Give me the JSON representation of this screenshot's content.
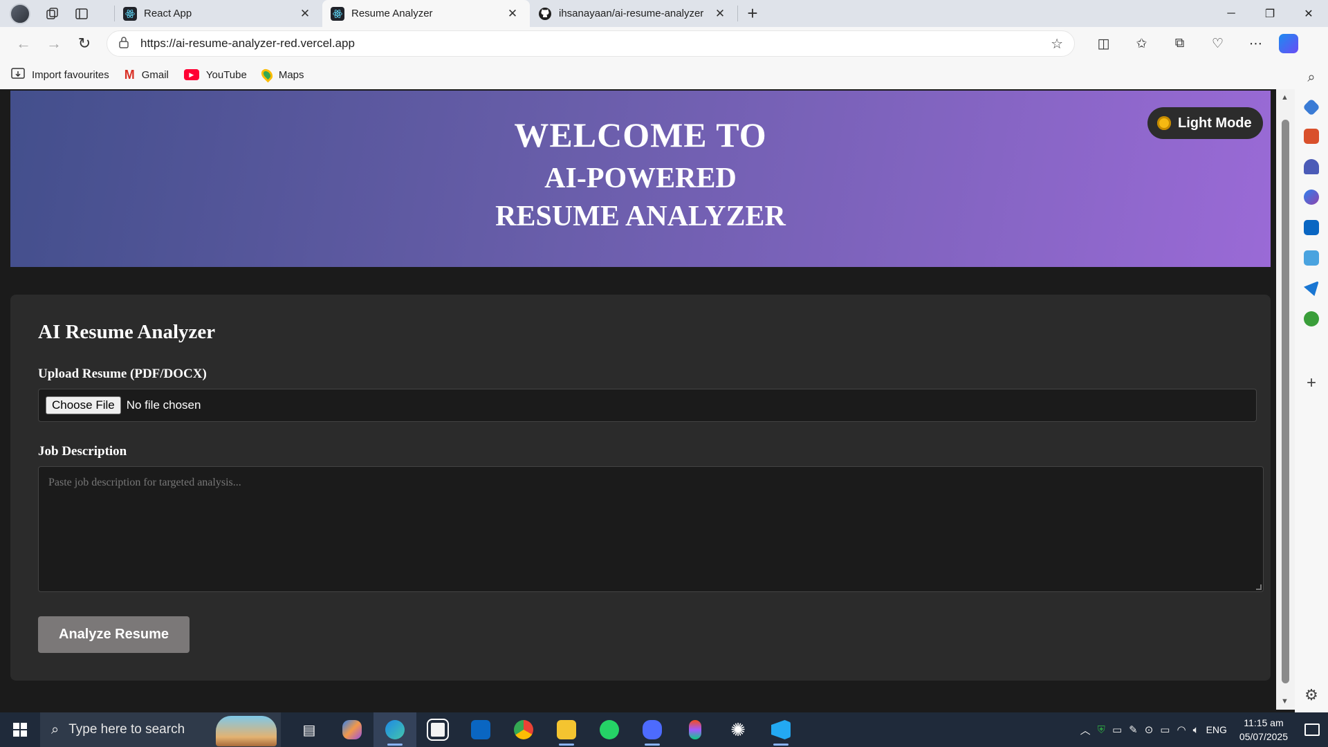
{
  "browser": {
    "tabs": [
      {
        "label": "React App",
        "active": false
      },
      {
        "label": "Resume Analyzer",
        "active": true
      },
      {
        "label": "ihsanayaan/ai-resume-analyzer",
        "active": false
      }
    ],
    "url": "https://ai-resume-analyzer-red.vercel.app",
    "favourites": [
      {
        "label": "Import favourites",
        "icon": "import-icon"
      },
      {
        "label": "Gmail",
        "icon": "gmail-icon"
      },
      {
        "label": "YouTube",
        "icon": "youtube-icon"
      },
      {
        "label": "Maps",
        "icon": "maps-icon"
      }
    ]
  },
  "hero": {
    "line1": "WELCOME TO",
    "line2": "AI-POWERED",
    "line3": "RESUME ANALYZER",
    "mode_button": "Light Mode",
    "gradient": [
      "#434f8c",
      "#9a6ad6"
    ]
  },
  "card": {
    "title": "AI Resume Analyzer",
    "upload_label": "Upload Resume (PDF/DOCX)",
    "choose_file": "Choose File",
    "no_file": "No file chosen",
    "jd_label": "Job Description",
    "jd_placeholder": "Paste job description for targeted analysis...",
    "analyze_button": "Analyze Resume"
  },
  "taskbar": {
    "search_placeholder": "Type here to search",
    "language": "ENG",
    "time": "11:15 am",
    "date": "05/07/2025"
  }
}
